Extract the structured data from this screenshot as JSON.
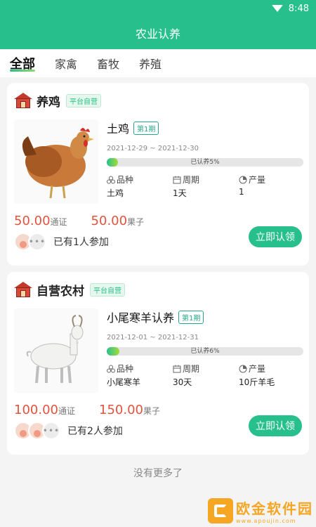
{
  "status_bar": {
    "time": "8:48"
  },
  "header": {
    "title": "农业认养"
  },
  "tabs": [
    {
      "label": "全部",
      "active": true
    },
    {
      "label": "家禽"
    },
    {
      "label": "畜牧"
    },
    {
      "label": "养殖"
    }
  ],
  "cards": [
    {
      "shop_name": "养鸡",
      "shop_badge": "平台自营",
      "product_icon": "chicken-image",
      "product_name": "土鸡",
      "period": "第1期",
      "dates": "2021-12-29 ~ 2021-12-30",
      "progress_text": "已认养5%",
      "progress_value": 0.05,
      "stats": [
        {
          "label": "品种",
          "value": "土鸡",
          "icon": "breed-icon"
        },
        {
          "label": "周期",
          "value": "1天",
          "icon": "calendar-icon"
        },
        {
          "label": "产量",
          "value": "1",
          "icon": "pie-icon"
        }
      ],
      "price1": "50.00",
      "unit1": "通证",
      "price2": "50.00",
      "unit2": "果子",
      "join_text": "已有1人参加",
      "button": "立即认领"
    },
    {
      "shop_name": "自营农村",
      "shop_badge": "平台自营",
      "product_icon": "goat-image",
      "product_name": "小尾寒羊认养",
      "period": "第1期",
      "dates": "2021-12-01 ~ 2021-12-31",
      "progress_text": "已认养6%",
      "progress_value": 0.06,
      "stats": [
        {
          "label": "品种",
          "value": "小尾寒羊",
          "icon": "breed-icon"
        },
        {
          "label": "周期",
          "value": "30天",
          "icon": "calendar-icon"
        },
        {
          "label": "产量",
          "value": "10斤羊毛",
          "icon": "pie-icon"
        }
      ],
      "price1": "100.00",
      "unit1": "通证",
      "price2": "150.00",
      "unit2": "果子",
      "join_text": "已有2人参加",
      "button": "立即认领"
    }
  ],
  "footer": {
    "no_more": "没有更多了"
  },
  "watermark": {
    "title": "欧金软件园",
    "url": "www.apoujin.com"
  }
}
